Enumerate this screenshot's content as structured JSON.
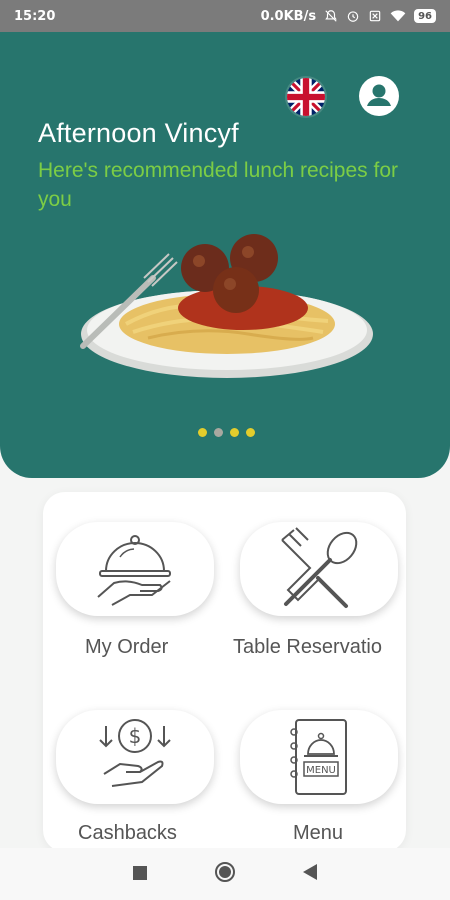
{
  "status_bar": {
    "time": "15:20",
    "network_speed": "0.0KB/s",
    "battery": "96"
  },
  "header": {
    "greeting": "Afternoon Vincyf",
    "subtitle": "Here's recommended lunch recipes for you",
    "language_icon": "uk-flag-icon",
    "profile_icon": "user-circle-icon"
  },
  "carousel": {
    "page_count": 4,
    "active_pages": [
      0,
      2,
      3
    ]
  },
  "menu": {
    "items": [
      {
        "label": "My Order",
        "icon": "cloche-hand-icon"
      },
      {
        "label": "Table Reservatio",
        "icon": "fork-spoon-icon"
      },
      {
        "label": "Cashbacks",
        "icon": "dollar-hand-icon"
      },
      {
        "label": "Menu",
        "icon": "menu-book-icon"
      }
    ]
  },
  "nav": {
    "icons": [
      "recents-square-icon",
      "home-circle-icon",
      "back-triangle-icon"
    ]
  },
  "colors": {
    "header_bg": "#27756d",
    "subtitle": "#7ccd45",
    "dot_active": "#e3cd2c",
    "dot_inactive": "#a9a8a0"
  }
}
